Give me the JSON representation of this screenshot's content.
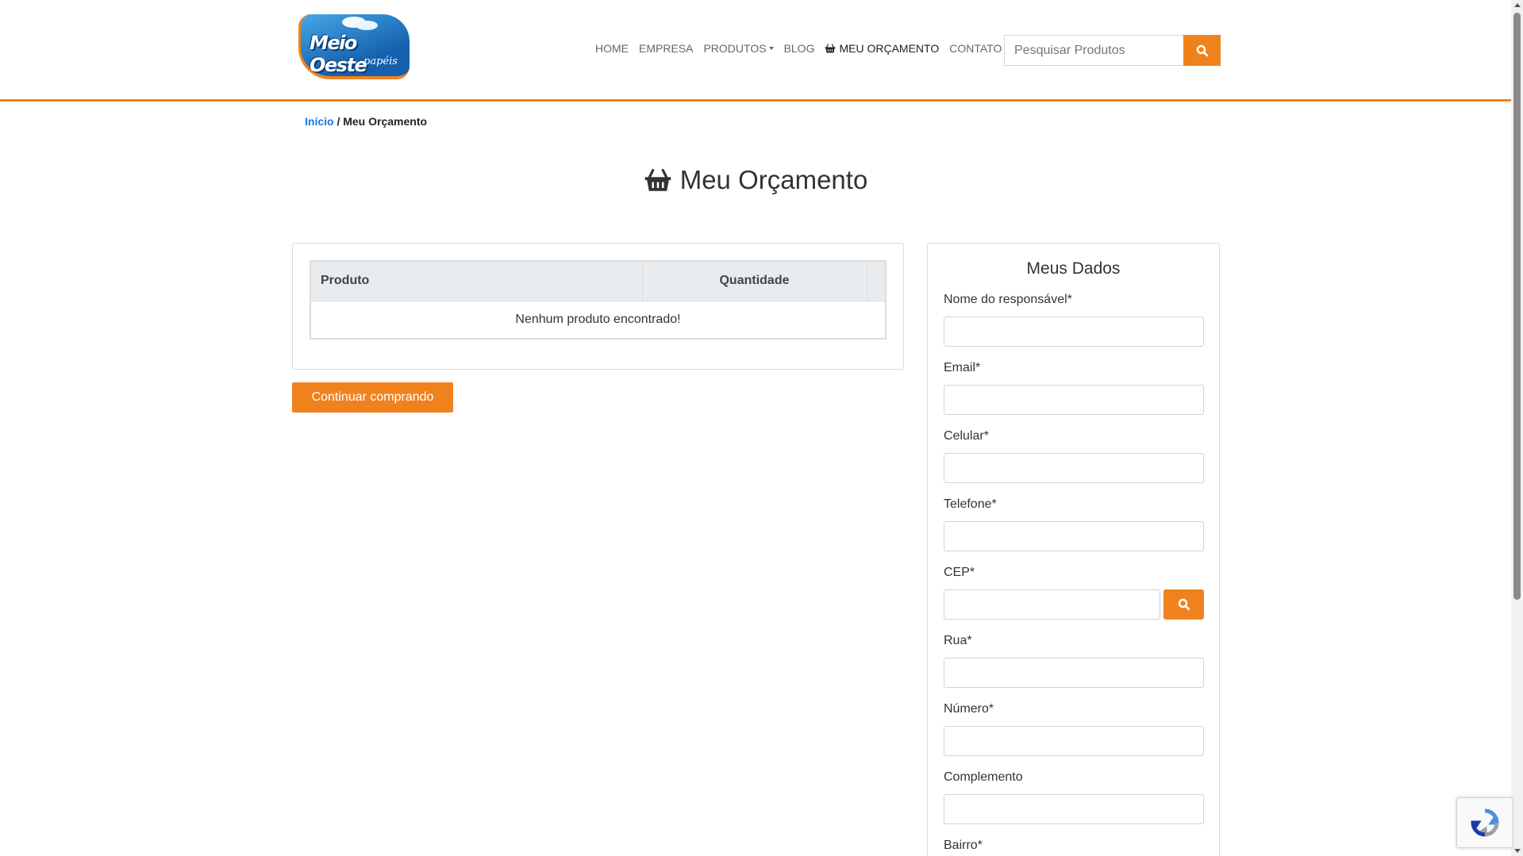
{
  "header": {
    "logo": {
      "brand": "Meio Oeste",
      "sub": "papéis"
    },
    "nav": [
      {
        "label": "HOME"
      },
      {
        "label": "EMPRESA"
      },
      {
        "label": "PRODUTOS",
        "has_caret": true
      },
      {
        "label": "BLOG"
      },
      {
        "label": "MEU ORÇAMENTO",
        "icon": "basket-icon",
        "active": true
      },
      {
        "label": "CONTATO"
      }
    ],
    "search": {
      "placeholder": "Pesquisar Produtos",
      "icon": "search-icon"
    }
  },
  "breadcrumb": {
    "home": "Início",
    "separator": " / ",
    "current": "Meu Orçamento"
  },
  "page": {
    "title": "Meu Orçamento",
    "title_icon": "basket-icon"
  },
  "cart": {
    "columns": {
      "product": "Produto",
      "quantity": "Quantidade"
    },
    "empty_message": "Nenhum produto encontrado!",
    "continue_label": "Continuar comprando"
  },
  "form": {
    "title": "Meus Dados",
    "fields": {
      "nome": "Nome do responsável*",
      "email": "Email*",
      "celular": "Celular*",
      "telefone": "Telefone*",
      "cep": "CEP*",
      "rua": "Rua*",
      "numero": "Número*",
      "complemento": "Complemento",
      "bairro": "Bairro*"
    }
  },
  "colors": {
    "accent": "#f0821e",
    "link": "#1a73e8",
    "table_header": "#e9ecef"
  }
}
